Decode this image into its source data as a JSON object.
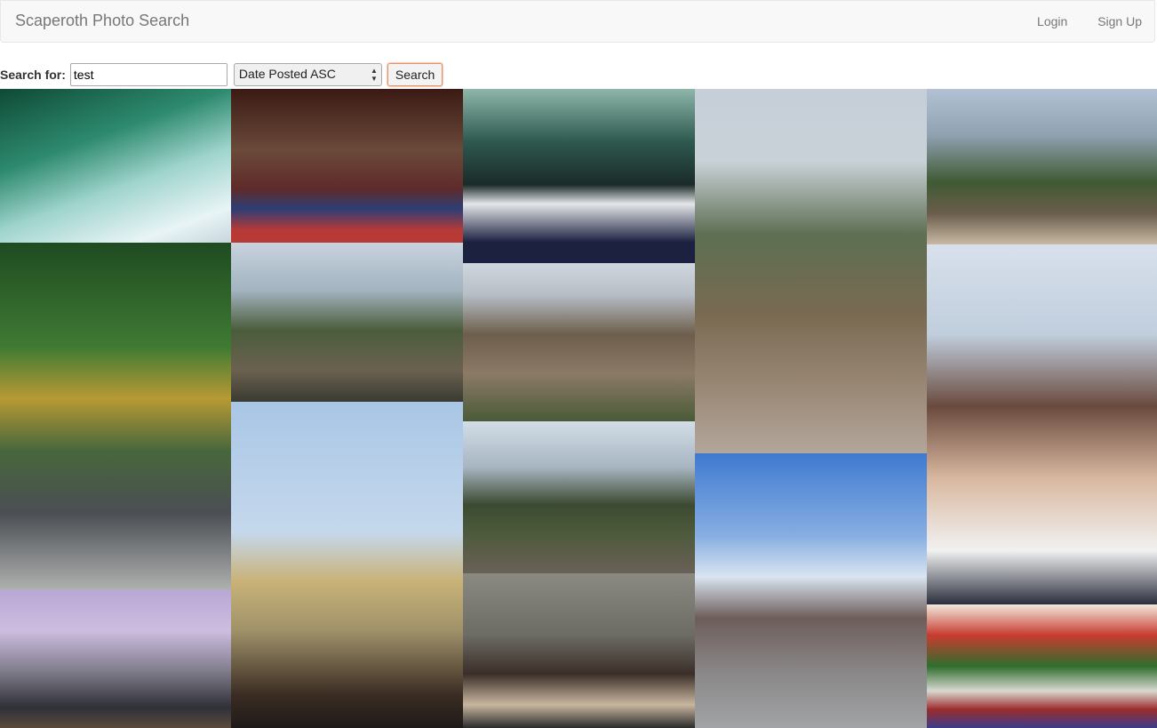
{
  "header": {
    "brand": "Scaperoth Photo Search",
    "login": "Login",
    "signup": "Sign Up"
  },
  "search": {
    "label": "Search for:",
    "value": "test",
    "sort": "Date Posted ASC",
    "button": "Search"
  },
  "photos": [
    {
      "name": "photo-glass-water",
      "bg": "linear-gradient(160deg,#0f4a36 0%,#2d8a6e 35%,#9fd4cd 60%,#e8f4f6 85%,#c8d6dc 100%)"
    },
    {
      "name": "photo-glass-tube",
      "bg": "linear-gradient(180deg,#3b1a14 0%,#6b4a3a 40%,#5f2a2a 65%,#2c3e75 78%,#b83a36 92%)"
    },
    {
      "name": "photo-mirror-room",
      "bg": "linear-gradient(180deg,#8fb6ab 0%,#2e5a50 30%,#1b2a28 55%,#e4e6e8 66%,#1c2140 88%)"
    },
    {
      "name": "photo-great-wall-valley",
      "bg": "linear-gradient(180deg,#c6ced8 0%,#c9d1d8 20%,#5d6f52 40%,#7a6a52 62%,#9a8876 82%,#b3a69a 100%)"
    },
    {
      "name": "photo-woman-great-wall",
      "bg": "linear-gradient(180deg,#b2c2d4 0%,#8fa1b0 30%,#3f5a33 60%,#6b5d4c 80%,#c9b9a4 100%)"
    },
    {
      "name": "photo-garden-statue",
      "bg": "linear-gradient(180deg,#1f4b21 0%,#3f7a34 30%,#b69a34 45%,#48673c 60%,#4b4e54 78%,#aeb0ad 100%)"
    },
    {
      "name": "photo-man-great-wall",
      "bg": "linear-gradient(180deg,#c8d3df 0%,#a3b3c0 30%,#4a5d3b 55%,#6b6150 80%,#3a3a32 100%)"
    },
    {
      "name": "photo-wall-ruins",
      "bg": "linear-gradient(180deg,#cfd6de 0%,#b7bec6 20%,#6d5e4c 45%,#8b7a66 70%,#4a5a38 100%)"
    },
    {
      "name": "photo-big-ben",
      "bg": "linear-gradient(180deg,#a9c6e6 0%,#c5d8ec 40%,#c9b277 55%,#a0926a 70%,#3a2c22 90%,#1e1a1a 100%)"
    },
    {
      "name": "photo-wall-hill",
      "bg": "linear-gradient(180deg,#d2dde6 0%,#a8b6c2 30%,#3b4a31 55%,#4f5b3c 75%,#6a6058 100%)"
    },
    {
      "name": "photo-red-square",
      "bg": "linear-gradient(180deg,#3f7ad0 0%,#87aee2 30%,#d9e4f0 45%,#6d5d5a 60%,#8a8888 80%,#a1a3a6 100%)"
    },
    {
      "name": "photo-three-women",
      "bg": "linear-gradient(180deg,#d8e0ec 0%,#c0cedd 25%,#6a4a3e 45%,#d9b8a0 65%,#f1f1f1 85%,#2b2f3d 100%)"
    },
    {
      "name": "photo-group-wall",
      "bg": "linear-gradient(180deg,#b8a7d4 0%,#cdbde0 30%,#7d7a88 60%,#2f3038 85%,#5a4a3c 100%)"
    },
    {
      "name": "photo-couple-wall",
      "bg": "linear-gradient(180deg,#8a8a82 0%,#6c6b64 40%,#3a2e28 65%,#c8b6a0 85%,#2b2b2b 100%)"
    },
    {
      "name": "photo-market-stall",
      "bg": "linear-gradient(180deg,#f1e8dc 0%,#c83b2f 25%,#2f6e2e 50%,#d8d8d0 70%,#9b2c2c 85%,#3c3c8a 100%)"
    }
  ]
}
